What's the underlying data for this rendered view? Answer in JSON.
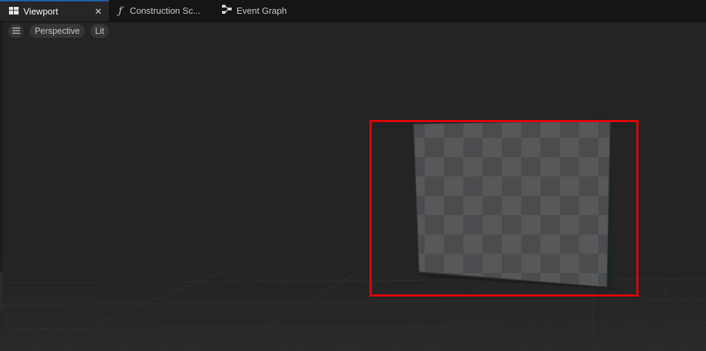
{
  "tabs": [
    {
      "label": "Viewport",
      "icon": "viewport-layout-icon",
      "close_glyph": "✕",
      "active": true
    },
    {
      "label": "Construction Sc...",
      "icon": "function-icon",
      "icon_glyph": "ƒ"
    },
    {
      "label": "Event Graph",
      "icon": "event-graph-icon"
    }
  ],
  "viewport_toolbar": {
    "menu_icon": "hamburger-menu-icon",
    "view_mode": "Perspective",
    "lighting": "Lit"
  },
  "colors": {
    "active_tab_accent": "#1f5fa8",
    "highlight": "#e80000",
    "checker_light": "#57585a",
    "checker_dark": "#4a4c4e"
  }
}
